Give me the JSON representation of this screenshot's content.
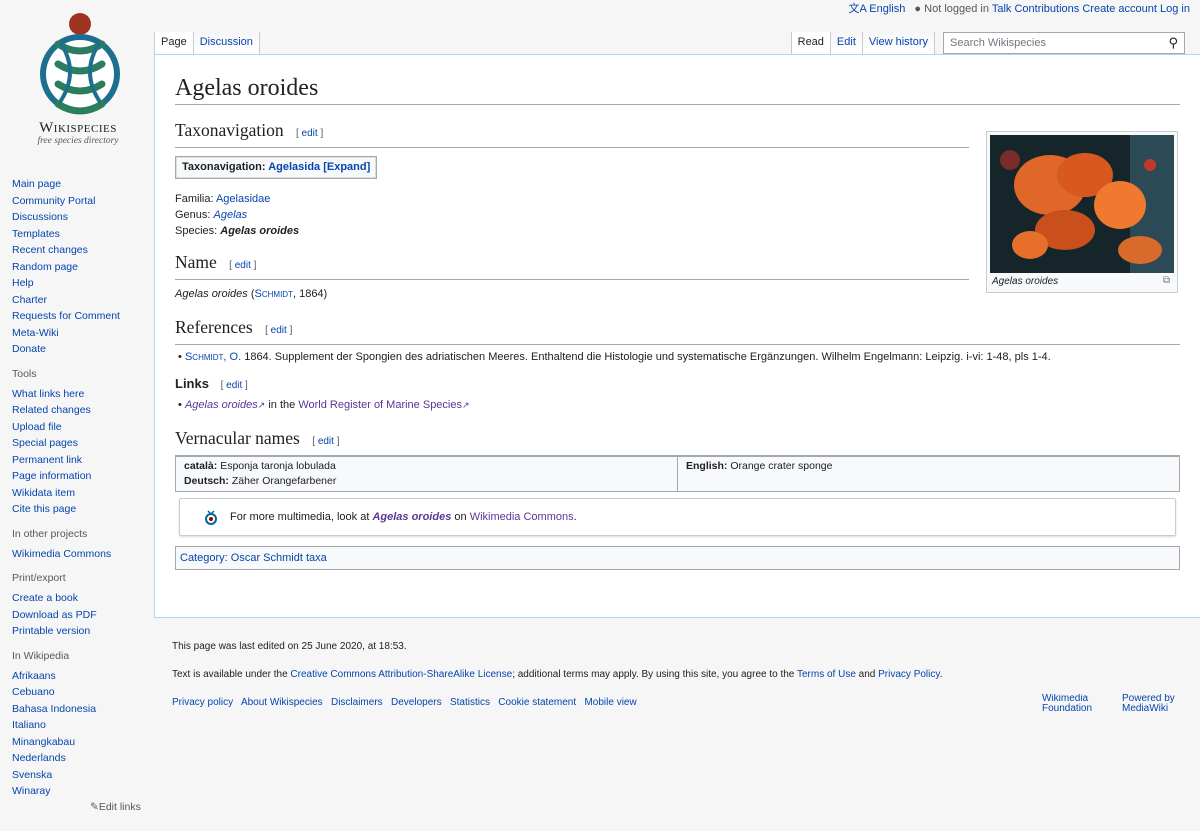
{
  "personal": {
    "language": "English",
    "not_logged_in": "Not logged in",
    "talk": "Talk",
    "contributions": "Contributions",
    "create_account": "Create account",
    "log_in": "Log in"
  },
  "logo": {
    "wordmark": "Wikispecies",
    "tagline": "free species directory"
  },
  "sidebar": {
    "navigation": [
      "Main page",
      "Community Portal",
      "Discussions",
      "Templates",
      "Recent changes",
      "Random page",
      "Help",
      "Charter",
      "Requests for Comment",
      "Meta-Wiki",
      "Donate"
    ],
    "tools_heading": "Tools",
    "tools": [
      "What links here",
      "Related changes",
      "Upload file",
      "Special pages",
      "Permanent link",
      "Page information",
      "Wikidata item",
      "Cite this page"
    ],
    "other_projects_heading": "In other projects",
    "other_projects": [
      "Wikimedia Commons"
    ],
    "print_heading": "Print/export",
    "print": [
      "Create a book",
      "Download as PDF",
      "Printable version"
    ],
    "languages_heading": "In Wikipedia",
    "languages": [
      "Afrikaans",
      "Cebuano",
      "Bahasa Indonesia",
      "Italiano",
      "Minangkabau",
      "Nederlands",
      "Svenska",
      "Winaray"
    ],
    "edit_links": "Edit links"
  },
  "tabs": {
    "page": "Page",
    "discussion": "Discussion",
    "read": "Read",
    "edit": "Edit",
    "view_history": "View history"
  },
  "search": {
    "placeholder": "Search Wikispecies"
  },
  "article": {
    "title": "Agelas oroides",
    "edit_label": "edit",
    "taxonavigation_heading": "Taxonavigation",
    "navbox_prefix": "Taxonavigation:",
    "navbox_link": "Agelasida",
    "navbox_expand": "[Expand]",
    "familia_label": "Familia:",
    "familia_value": "Agelasidae",
    "genus_label": "Genus:",
    "genus_value": "Agelas",
    "species_label": "Species:",
    "species_value": "Agelas oroides",
    "name_heading": "Name",
    "name_species": "Agelas oroides",
    "name_open": "(",
    "name_author": "Schmidt",
    "name_year": ", 1864)",
    "references_heading": "References",
    "ref_author": "Schmidt, O.",
    "ref_text": "1864. Supplement der Spongien des adriatischen Meeres. Enthaltend die Histologie und systematische Ergänzungen. Wilhelm Engelmann: Leipzig. i-vi: 1-48, pls 1-4.",
    "links_heading": "Links",
    "link_species": "Agelas oroides",
    "link_in_the": "in the",
    "link_worms": "World Register of Marine Species",
    "vernacular_heading": "Vernacular names",
    "vernacular": [
      {
        "lang": "català:",
        "name": "Esponja taronja lobulada"
      },
      {
        "lang": "Deutsch:",
        "name": "Zäher Orangefarbener"
      },
      {
        "lang": "English:",
        "name": "Orange crater sponge"
      }
    ],
    "commons_prefix": "For more multimedia, look at",
    "commons_species": "Agelas oroides",
    "commons_on": "on",
    "commons_link": "Wikimedia Commons",
    "commons_end": ".",
    "category_label": "Category:",
    "category_value": "Oscar Schmidt taxa",
    "thumb_caption": "Agelas oroides"
  },
  "footer": {
    "last_edited": "This page was last edited on 25 June 2020, at 18:53.",
    "license_prefix": "Text is available under the",
    "license_link": "Creative Commons Attribution-ShareAlike License",
    "license_mid": "; additional terms may apply. By using this site, you agree to the",
    "terms_link": "Terms of Use",
    "and": "and",
    "privacy_link": "Privacy Policy",
    "period": ".",
    "places": [
      "Privacy policy",
      "About Wikispecies",
      "Disclaimers",
      "Developers",
      "Statistics",
      "Cookie statement",
      "Mobile view"
    ],
    "wikimedia_icon": "Wikimedia Foundation",
    "mediawiki_icon": "Powered by MediaWiki"
  }
}
